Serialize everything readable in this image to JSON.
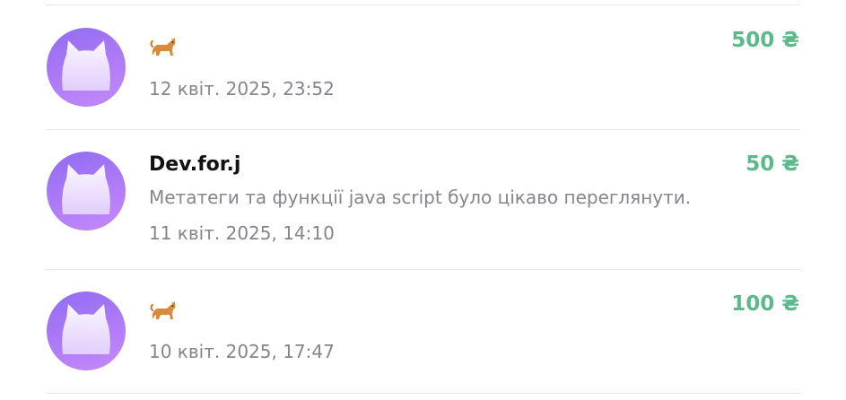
{
  "colors": {
    "amount": "#5bb98a",
    "avatar_gradient_start": "#8f6cf2",
    "avatar_gradient_end": "#c48af9",
    "secondary_text": "#85858f",
    "divider": "#e6e6ea"
  },
  "donations": [
    {
      "name": "",
      "emoji": "🐈",
      "message": "",
      "time": "12 квіт. 2025, 23:52",
      "amount": "500 ₴",
      "avatar_icon": "cat-face-icon"
    },
    {
      "name": "Dev.for.j",
      "emoji": "",
      "message": "Метатеги та функції java script було цікаво переглянути.",
      "time": "11 квіт. 2025, 14:10",
      "amount": "50 ₴",
      "avatar_icon": "cat-face-icon"
    },
    {
      "name": "",
      "emoji": "🐈",
      "message": "",
      "time": "10 квіт. 2025, 17:47",
      "amount": "100 ₴",
      "avatar_icon": "cat-face-icon"
    }
  ]
}
